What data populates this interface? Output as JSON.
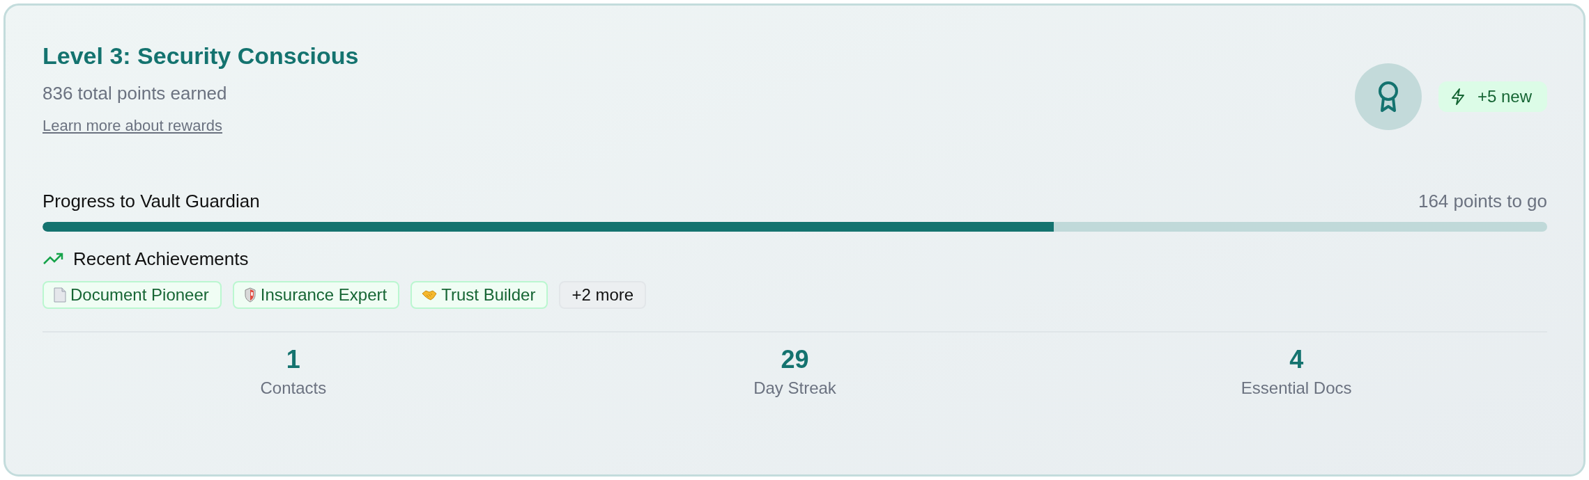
{
  "header": {
    "title": "Level 3: Security Conscious",
    "points": "836 total points earned",
    "link": "Learn more about rewards",
    "new_badge": "+5 new"
  },
  "progress": {
    "label": "Progress to Vault Guardian",
    "remaining": "164 points to go",
    "level": 0.672
  },
  "achievements": {
    "title": "Recent Achievements",
    "badges": [
      {
        "label": "Document Pioneer",
        "kind": "earned"
      },
      {
        "label": "Insurance Expert",
        "kind": "earned"
      },
      {
        "label": "Trust Builder",
        "kind": "earned"
      },
      {
        "label": "+2 more",
        "kind": "more"
      }
    ]
  },
  "stats": [
    {
      "value": "1",
      "label": "Contacts"
    },
    {
      "value": "29",
      "label": "Day Streak"
    },
    {
      "value": "4",
      "label": "Essential Docs"
    }
  ]
}
